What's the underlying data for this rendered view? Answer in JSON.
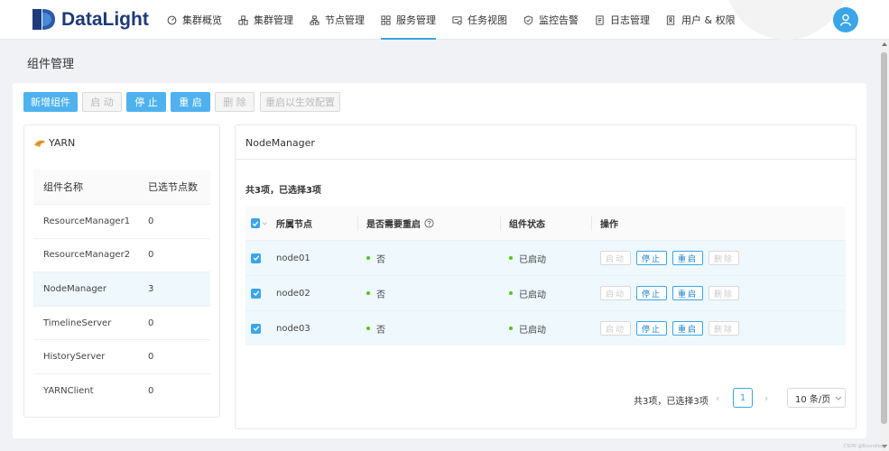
{
  "app": {
    "brand": "DataLight",
    "nav": [
      {
        "label": "集群概览",
        "icon": "dashboard-icon"
      },
      {
        "label": "集群管理",
        "icon": "cluster-icon"
      },
      {
        "label": "节点管理",
        "icon": "node-tree-icon"
      },
      {
        "label": "服务管理",
        "icon": "grid-icon"
      },
      {
        "label": "任务视图",
        "icon": "task-view-icon"
      },
      {
        "label": "监控告警",
        "icon": "shield-icon"
      },
      {
        "label": "日志管理",
        "icon": "log-icon"
      },
      {
        "label": "用户 & 权限",
        "icon": "user-permission-icon"
      }
    ],
    "active_nav": "服务管理",
    "accent_color": "#3aa6e8"
  },
  "page": {
    "title": "组件管理"
  },
  "toolbar": {
    "add": "新增组件",
    "start": "启 动",
    "stop": "停 止",
    "restart": "重 启",
    "delete": "删 除",
    "restart_apply": "重启以生效配置"
  },
  "service": {
    "name": "YARN",
    "icon": "yarn-icon",
    "columns": [
      "组件名称",
      "已选节点数"
    ],
    "components": [
      {
        "name": "ResourceManager1",
        "count": "0"
      },
      {
        "name": "ResourceManager2",
        "count": "0"
      },
      {
        "name": "NodeManager",
        "count": "3"
      },
      {
        "name": "TimelineServer",
        "count": "0"
      },
      {
        "name": "HistoryServer",
        "count": "0"
      },
      {
        "name": "YARNClient",
        "count": "0"
      }
    ],
    "selected": "NodeManager"
  },
  "detail": {
    "title": "NodeManager",
    "summary": "共3项，已选择3项",
    "columns": [
      "所属节点",
      "是否需要重启",
      "组件状态",
      "操作"
    ],
    "rows": [
      {
        "node": "node01",
        "restart": "否",
        "status": "已启动"
      },
      {
        "node": "node02",
        "restart": "否",
        "status": "已启动"
      },
      {
        "node": "node03",
        "restart": "否",
        "status": "已启动"
      }
    ],
    "actions": {
      "start": "启动",
      "stop": "停止",
      "restart": "重启",
      "delete": "删除"
    },
    "status_color": "#52c41a"
  },
  "pagination": {
    "info": "共3项，已选择3项",
    "current": "1",
    "page_size": "10 条/页"
  },
  "watermark": "CSDN @Boundless"
}
